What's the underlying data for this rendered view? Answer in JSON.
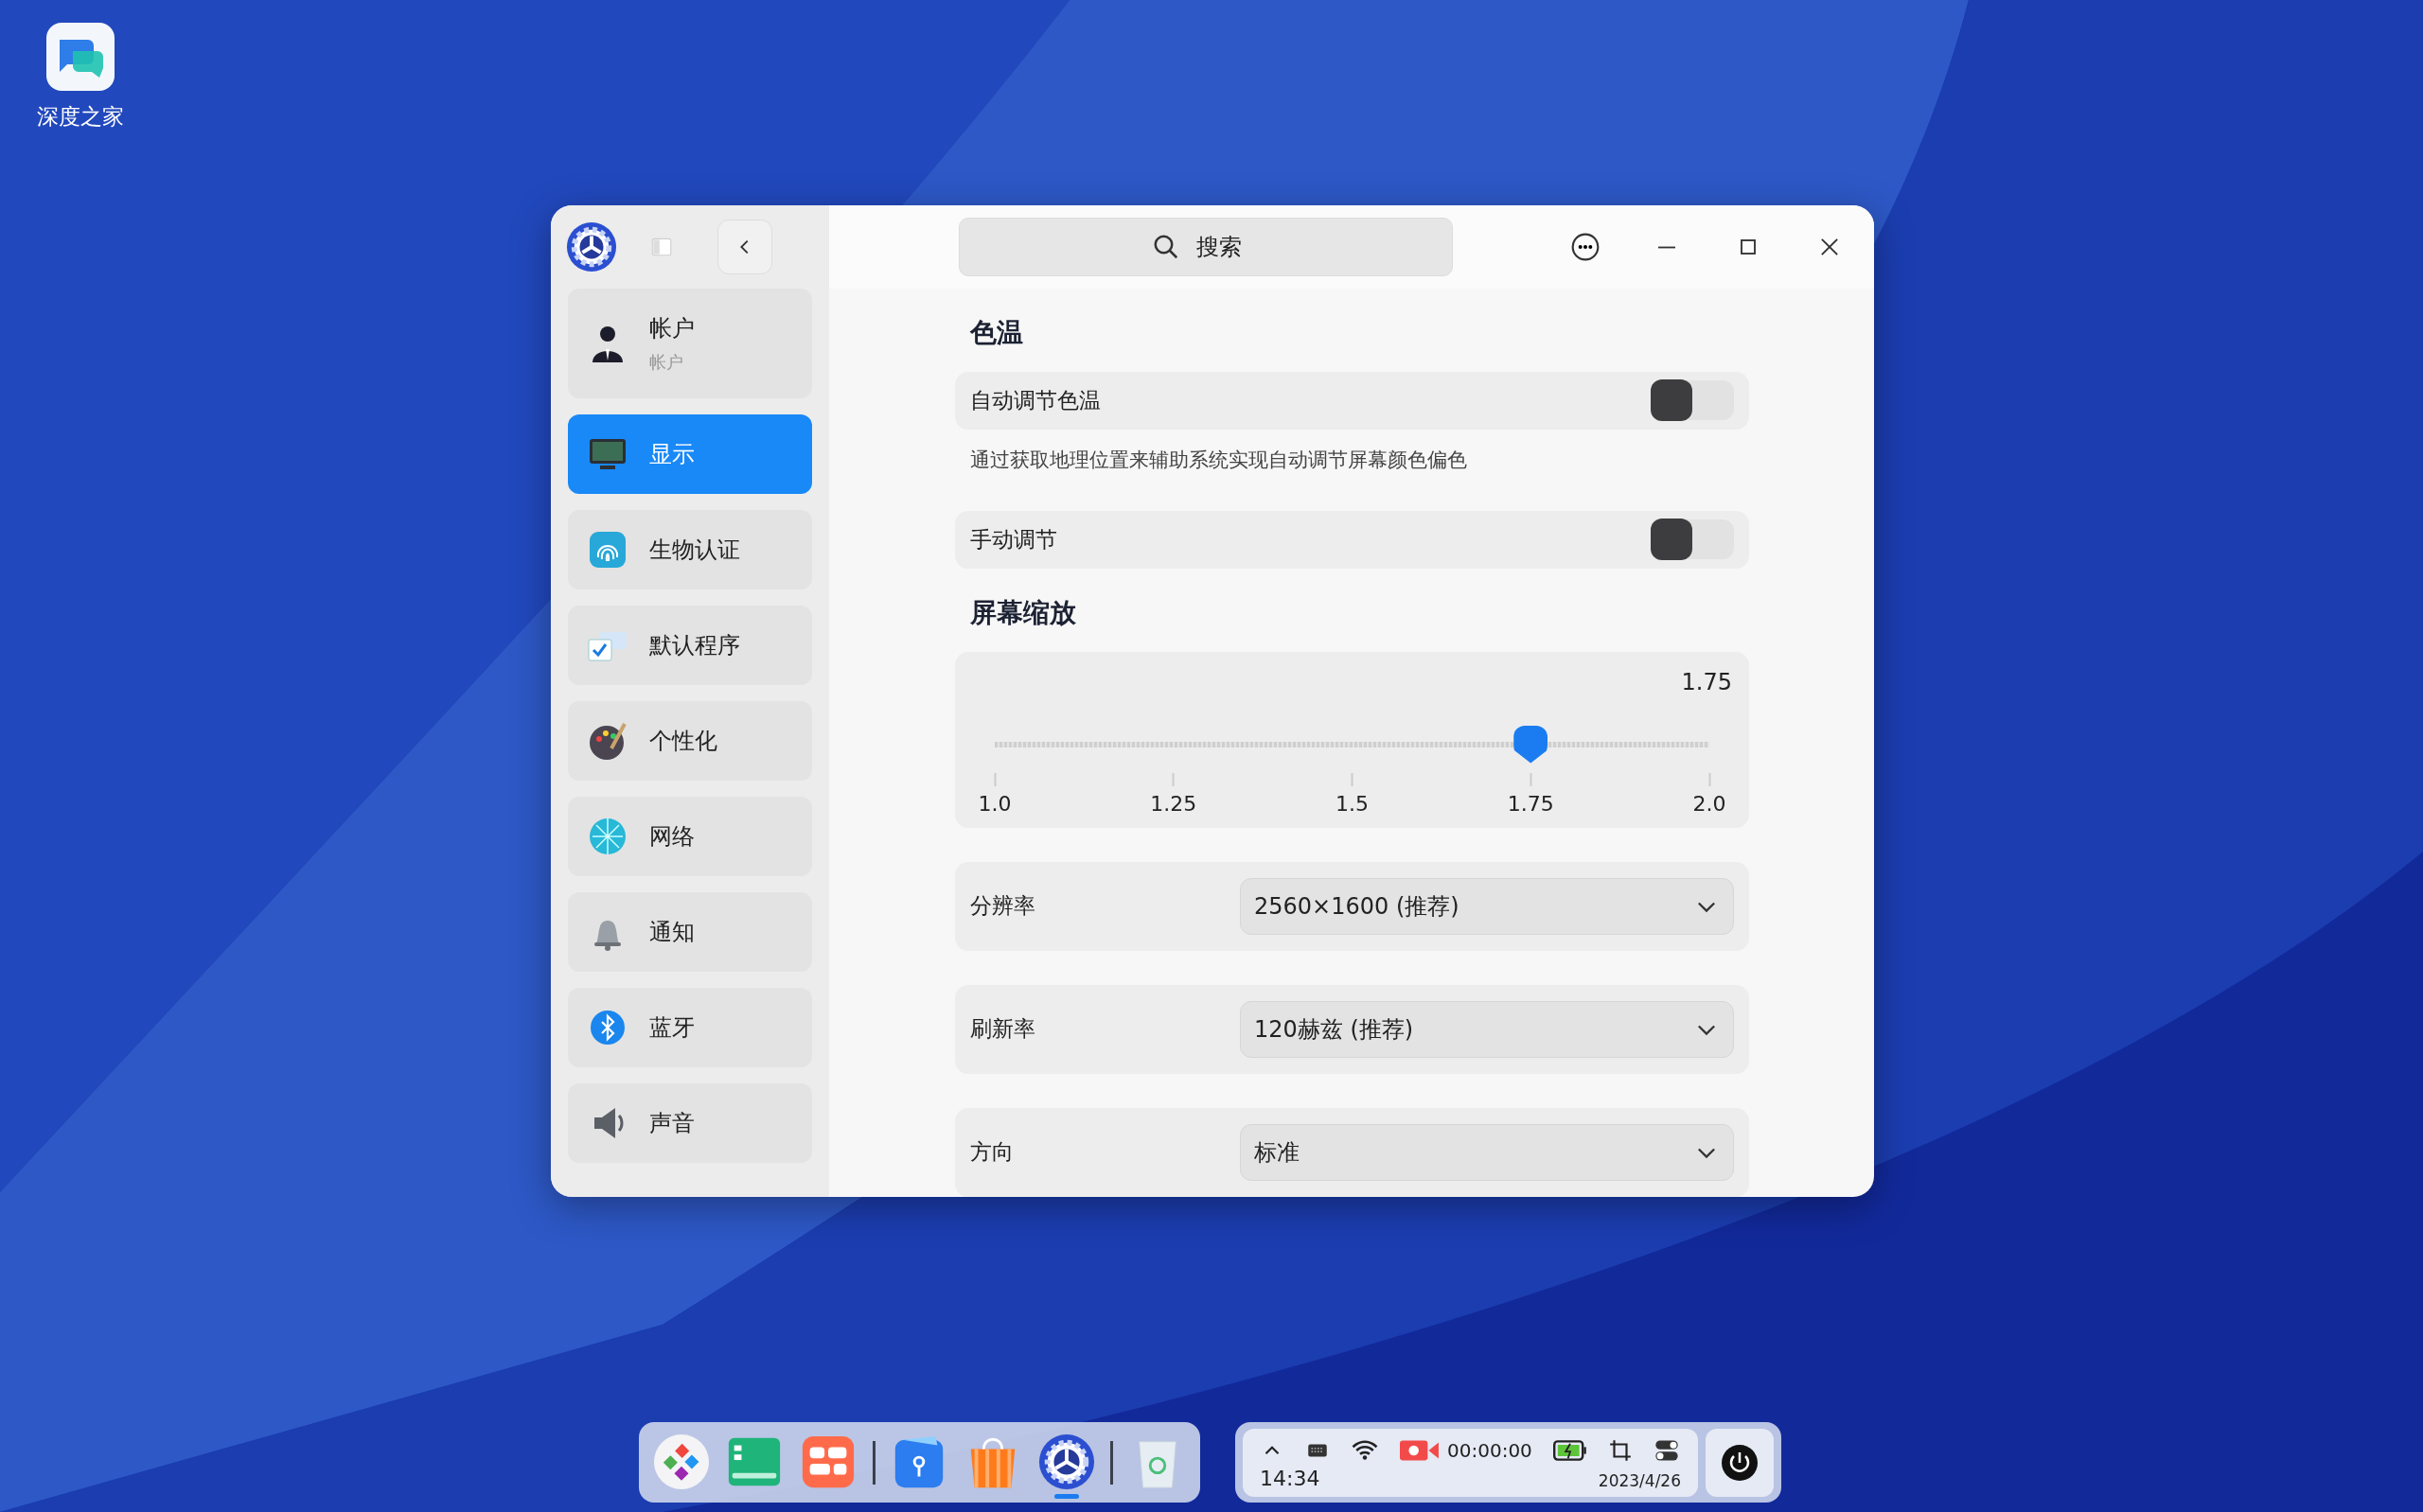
{
  "desktop": {
    "icons": [
      {
        "label": "深度之家"
      }
    ]
  },
  "window": {
    "search": {
      "placeholder": "搜索"
    },
    "sidebar": {
      "items": [
        {
          "label": "帐户",
          "subtitle": "帐户",
          "selected": false
        },
        {
          "label": "显示",
          "selected": true
        },
        {
          "label": "生物认证",
          "selected": false
        },
        {
          "label": "默认程序",
          "selected": false
        },
        {
          "label": "个性化",
          "selected": false
        },
        {
          "label": "网络",
          "selected": false
        },
        {
          "label": "通知",
          "selected": false
        },
        {
          "label": "蓝牙",
          "selected": false
        },
        {
          "label": "声音",
          "selected": false
        }
      ]
    },
    "sections": [
      {
        "title": "色温",
        "rows": [
          {
            "kind": "toggle",
            "label": "自动调节色温",
            "on": false,
            "description": "通过获取地理位置来辅助系统实现自动调节屏幕颜色偏色"
          },
          {
            "kind": "toggle",
            "label": "手动调节",
            "on": false
          }
        ]
      },
      {
        "title": "屏幕缩放",
        "rows": [
          {
            "kind": "slider",
            "reading": "1.75",
            "level": 0.75,
            "ticks": [
              "1.0",
              "1.25",
              "1.5",
              "1.75",
              "2.0"
            ]
          },
          {
            "kind": "select",
            "label": "分辨率",
            "value": "2560×1600 (推荐)"
          },
          {
            "kind": "select",
            "label": "刷新率",
            "value": "120赫兹 (推荐)"
          },
          {
            "kind": "select",
            "label": "方向",
            "value": "标准"
          }
        ]
      }
    ]
  },
  "dock": {
    "apps": [
      {
        "running": false
      },
      {
        "running": false
      },
      {
        "running": false
      },
      {
        "running": false
      },
      {
        "running": false
      },
      {
        "running": true
      },
      {
        "running": false
      }
    ]
  },
  "tray": {
    "recording_time": "00:00:00",
    "time": "14:34",
    "date": "2023/4/26"
  }
}
